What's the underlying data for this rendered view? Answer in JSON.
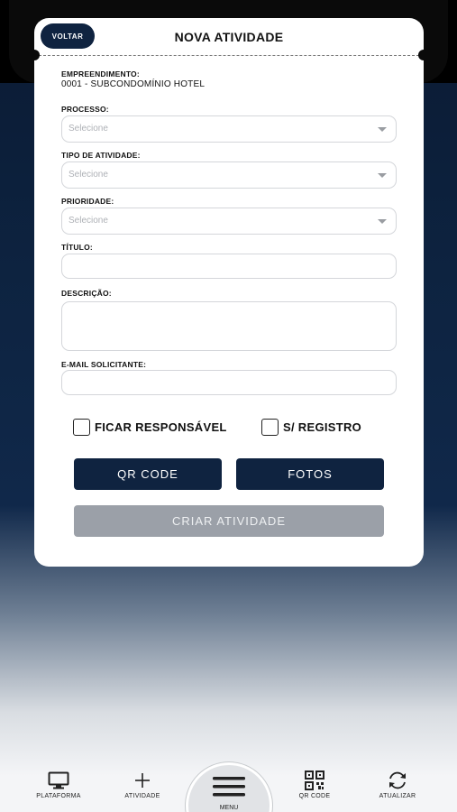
{
  "header": {
    "back_label": "VOLTAR",
    "title": "NOVA ATIVIDADE"
  },
  "form": {
    "empreendimento": {
      "label": "EMPREENDIMENTO:",
      "value": "0001 - SUBCONDOMÍNIO HOTEL"
    },
    "processo": {
      "label": "PROCESSO:",
      "placeholder": "Selecione"
    },
    "tipo": {
      "label": "TIPO DE ATIVIDADE:",
      "placeholder": "Selecione"
    },
    "prioridade": {
      "label": "PRIORIDADE:",
      "placeholder": "Selecione"
    },
    "titulo": {
      "label": "TÍTULO:",
      "value": ""
    },
    "descricao": {
      "label": "DESCRIÇÃO:",
      "value": ""
    },
    "email": {
      "label": "E-MAIL SOLICITANTE:",
      "value": ""
    }
  },
  "checks": {
    "responsavel": {
      "label": "FICAR RESPONSÁVEL",
      "checked": false
    },
    "registro": {
      "label": "S/ REGISTRO",
      "checked": false
    }
  },
  "buttons": {
    "qr": "QR CODE",
    "fotos": "FOTOS",
    "criar": "CRIAR ATIVIDADE"
  },
  "nav": {
    "plataforma": "PLATAFORMA",
    "atividade": "ATIVIDADE",
    "menu": "MENU",
    "qrcode": "QR CODE",
    "atualizar": "ATUALIZAR"
  },
  "colors": {
    "primary": "#0f2340",
    "disabled": "#9ba0a8"
  }
}
